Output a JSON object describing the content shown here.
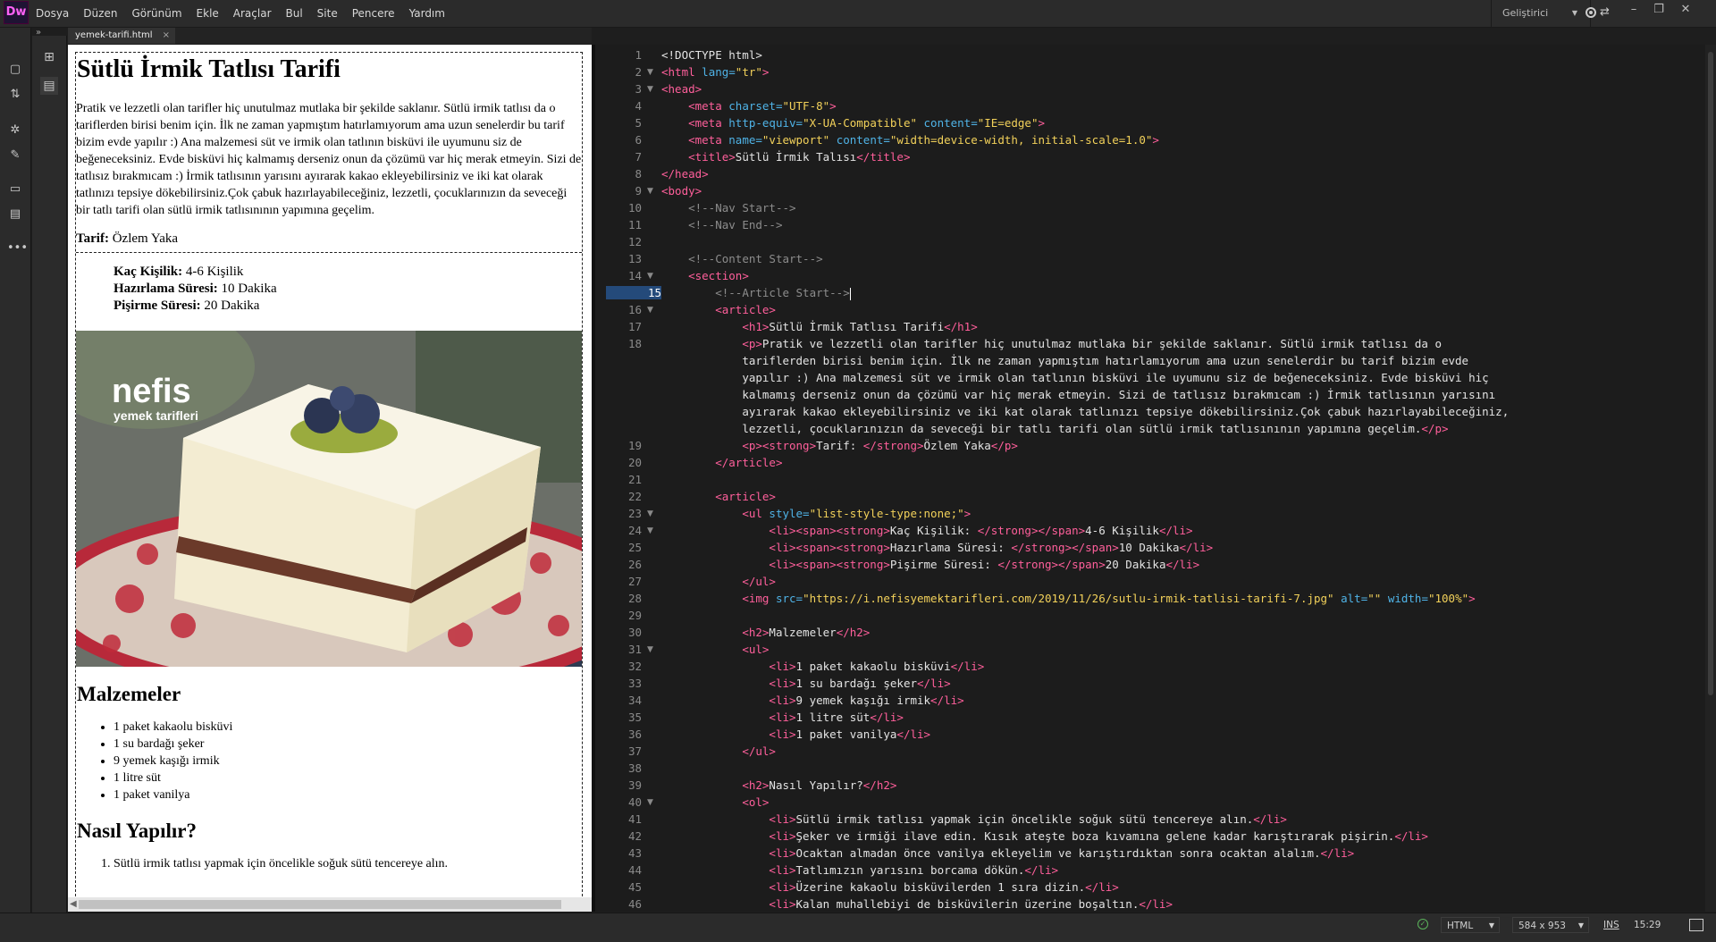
{
  "app": {
    "logo": "Dw"
  },
  "menu": [
    "Dosya",
    "Düzen",
    "Görünüm",
    "Ekle",
    "Araçlar",
    "Bul",
    "Site",
    "Pencere",
    "Yardım"
  ],
  "workspace": "Geliştirici",
  "document_tab": {
    "label": "yemek-tarifi.html",
    "close": "×"
  },
  "design": {
    "title": "Sütlü İrmik Tatlısı Tarifi",
    "intro": "Pratik ve lezzetli olan tarifler hiç unutulmaz mutlaka bir şekilde saklanır. Sütlü irmik tatlısı da o tariflerden birisi benim için. İlk ne zaman yapmıştım hatırlamıyorum ama uzun senelerdir bu tarif bizim evde yapılır :) Ana malzemesi süt ve irmik olan tatlının bisküvi ile uyumunu siz de beğeneceksiniz. Evde bisküvi hiç kalmamış derseniz onun da çözümü var hiç merak etmeyin. Sizi de tatlısız bırakmıcam :) İrmik tatlısının yarısını ayırarak kakao ekleyebilirsiniz ve iki kat olarak tatlınızı tepsiye dökebilirsiniz.Çok çabuk hazırlayabileceğiniz, lezzetli, çocuklarınızın da seveceği bir tatlı tarifi olan sütlü irmik tatlısınının yapımına geçelim.",
    "author_label": "Tarif:",
    "author": "Özlem Yaka",
    "info": [
      {
        "label": "Kaç Kişilik:",
        "value": "4-6 Kişilik"
      },
      {
        "label": "Hazırlama Süresi:",
        "value": "10 Dakika"
      },
      {
        "label": "Pişirme Süresi:",
        "value": "20 Dakika"
      }
    ],
    "image_brand": "nefis",
    "image_brand_sub": "yemek tarifleri",
    "ingredients_title": "Malzemeler",
    "ingredients": [
      "1 paket kakaolu bisküvi",
      "1 su bardağı şeker",
      "9 yemek kaşığı irmik",
      "1 litre süt",
      "1 paket vanilya"
    ],
    "steps_title": "Nasıl Yapılır?",
    "steps": [
      "Sütlü irmik tatlısı yapmak için öncelikle soğuk sütü tencereye alın."
    ]
  },
  "code_lines": [
    "1",
    "2",
    "3",
    "4",
    "5",
    "6",
    "7",
    "8",
    "9",
    "10",
    "11",
    "12",
    "13",
    "14",
    "15",
    "16",
    "17",
    "18",
    "19",
    "20",
    "21",
    "22",
    "23",
    "24",
    "25",
    "26",
    "27",
    "28",
    "29",
    "30",
    "31",
    "32",
    "33",
    "34",
    "35",
    "36",
    "37",
    "38",
    "39",
    "40",
    "41",
    "42",
    "43",
    "44",
    "45",
    "46"
  ],
  "code": {
    "l1": "<!DOCTYPE html>",
    "l2a": "<html",
    "l2b": " lang=",
    "l2c": "\"tr\"",
    "l2d": ">",
    "l3": "<head>",
    "l4a": "<meta",
    "l4b": " charset=",
    "l4c": "\"UTF-8\"",
    "l4d": ">",
    "l5a": "<meta",
    "l5b": " http-equiv=",
    "l5c": "\"X-UA-Compatible\"",
    "l5e": " content=",
    "l5f": "\"IE=edge\"",
    "l5d": ">",
    "l6a": "<meta",
    "l6b": " name=",
    "l6c": "\"viewport\"",
    "l6e": " content=",
    "l6f": "\"width=device-width, initial-scale=1.0\"",
    "l6d": ">",
    "l7a": "<title>",
    "l7b": "Sütlü İrmik Talısı",
    "l7c": "</title>",
    "l8": "</head>",
    "l9": "<body>",
    "l10": "<!--Nav Start-->",
    "l11": "<!--Nav End-->",
    "l13": "<!--Content Start-->",
    "l14": "<section>",
    "l15": "<!--Article Start-->",
    "l16": "<article>",
    "l17a": "<h1>",
    "l17b": "Sütlü İrmik Tatlısı Tarifi",
    "l17c": "</h1>",
    "l18a": "<p>",
    "l18b": "Pratik ve lezzetli olan tarifler hiç unutulmaz mutlaka bir şekilde saklanır. Sütlü irmik tatlısı da o",
    "l18w1": "tariflerden birisi benim için. İlk ne zaman yapmıştım hatırlamıyorum ama uzun senelerdir bu tarif bizim evde",
    "l18w2": "yapılır :) Ana malzemesi süt ve irmik olan tatlının bisküvi ile uyumunu siz de beğeneceksiniz. Evde bisküvi hiç",
    "l18w3": "kalmamış derseniz onun da çözümü var hiç merak etmeyin. Sizi de tatlısız bırakmıcam :) İrmik tatlısının yarısını",
    "l18w4": "ayırarak kakao ekleyebilirsiniz ve iki kat olarak tatlınızı tepsiye dökebilirsiniz.Çok çabuk hazırlayabileceğiniz,",
    "l18w5": "lezzetli, çocuklarınızın da seveceği bir tatlı tarifi olan sütlü irmik tatlısınının yapımına geçelim.",
    "l18w5c": "</p>",
    "l19a": "<p><strong>",
    "l19b": "Tarif: ",
    "l19c": "</strong>",
    "l19d": "Özlem Yaka",
    "l19e": "</p>",
    "l20": "</article>",
    "l22": "<article>",
    "l23a": "<ul",
    "l23b": " style=",
    "l23c": "\"list-style-type:none;\"",
    "l23d": ">",
    "l24a": "<li><span><strong>",
    "l24b": "Kaç Kişilik: ",
    "l24c": "</strong></span>",
    "l24d": "4-6 Kişilik",
    "l24e": "</li>",
    "l25a": "<li><span><strong>",
    "l25b": "Hazırlama Süresi: ",
    "l25c": "</strong></span>",
    "l25d": "10 Dakika",
    "l25e": "</li>",
    "l26a": "<li><span><strong>",
    "l26b": "Pişirme Süresi: ",
    "l26c": "</strong></span>",
    "l26d": "20 Dakika",
    "l26e": "</li>",
    "l27": "</ul>",
    "l28a": "<img",
    "l28b": " src=",
    "l28c": "\"https://i.nefisyemektarifleri.com/2019/11/26/sutlu-irmik-tatlisi-tarifi-7.jpg\"",
    "l28e": " alt=",
    "l28f": "\"\"",
    "l28g": " width=",
    "l28h": "\"100%\"",
    "l28d": ">",
    "l30a": "<h2>",
    "l30b": "Malzemeler",
    "l30c": "</h2>",
    "l31": "<ul>",
    "l32a": "<li>",
    "l32b": "1 paket kakaolu bisküvi",
    "l32c": "</li>",
    "l33a": "<li>",
    "l33b": "1 su bardağı şeker",
    "l33c": "</li>",
    "l34a": "<li>",
    "l34b": "9 yemek kaşığı irmik",
    "l34c": "</li>",
    "l35a": "<li>",
    "l35b": "1 litre süt",
    "l35c": "</li>",
    "l36a": "<li>",
    "l36b": "1 paket vanilya",
    "l36c": "</li>",
    "l37": "</ul>",
    "l39a": "<h2>",
    "l39b": "Nasıl Yapılır?",
    "l39c": "</h2>",
    "l40": "<ol>",
    "l41a": "<li>",
    "l41b": "Sütlü irmik tatlısı yapmak için öncelikle soğuk sütü tencereye alın.",
    "l41c": "</li>",
    "l42a": "<li>",
    "l42b": "Şeker ve irmiği ilave edin. Kısık ateşte boza kıvamına gelene kadar karıştırarak pişirin.",
    "l42c": "</li>",
    "l43a": "<li>",
    "l43b": "Ocaktan almadan önce vanilya ekleyelim ve karıştırdıktan sonra ocaktan alalım.",
    "l43c": "</li>",
    "l44a": "<li>",
    "l44b": "Tatlımızın yarısını borcama dökün.",
    "l44c": "</li>",
    "l45a": "<li>",
    "l45b": "Üzerine kakaolu bisküvilerden 1 sıra dizin.",
    "l45c": "</li>",
    "l46a": "<li>",
    "l46b": "Kalan muhallebiyi de bisküvilerin üzerine boşaltın.",
    "l46c": "</li>"
  },
  "status": {
    "language": "HTML",
    "size": "584 x 953",
    "mode": "INS",
    "position": "15:29"
  },
  "icons": [
    "new-document-icon",
    "file-transfer-icon",
    "code-hint-icon",
    "brush-icon",
    "comment-icon",
    "snippet-icon",
    "more-icon",
    "dom-panel-icon",
    "assets-panel-icon"
  ]
}
